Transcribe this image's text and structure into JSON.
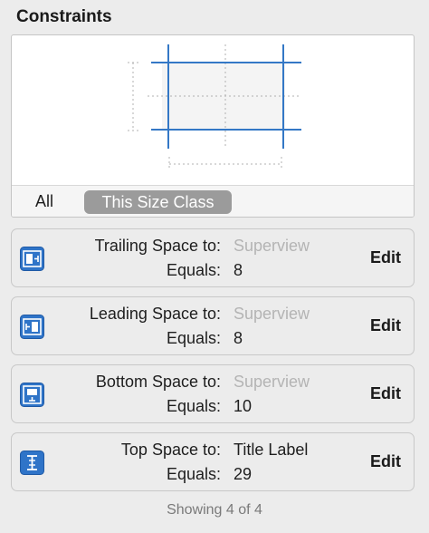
{
  "panel": {
    "title": "Constraints"
  },
  "filter": {
    "all_label": "All",
    "size_class_label": "This Size Class"
  },
  "constraints": [
    {
      "label": "Trailing Space to:",
      "target": "Superview",
      "target_muted": true,
      "equals_label": "Equals:",
      "value": "8",
      "edit_label": "Edit",
      "icon": "trailing-space-icon"
    },
    {
      "label": "Leading Space to:",
      "target": "Superview",
      "target_muted": true,
      "equals_label": "Equals:",
      "value": "8",
      "edit_label": "Edit",
      "icon": "leading-space-icon"
    },
    {
      "label": "Bottom Space to:",
      "target": "Superview",
      "target_muted": true,
      "equals_label": "Equals:",
      "value": "10",
      "edit_label": "Edit",
      "icon": "bottom-space-icon"
    },
    {
      "label": "Top Space to:",
      "target": "Title Label",
      "target_muted": false,
      "equals_label": "Equals:",
      "value": "29",
      "edit_label": "Edit",
      "icon": "top-space-icon"
    }
  ],
  "footer": {
    "count_text": "Showing 4 of 4"
  },
  "colors": {
    "accent": "#3478c6",
    "icon_bg": "#2f74c8",
    "dotted": "#b0b0b0"
  }
}
